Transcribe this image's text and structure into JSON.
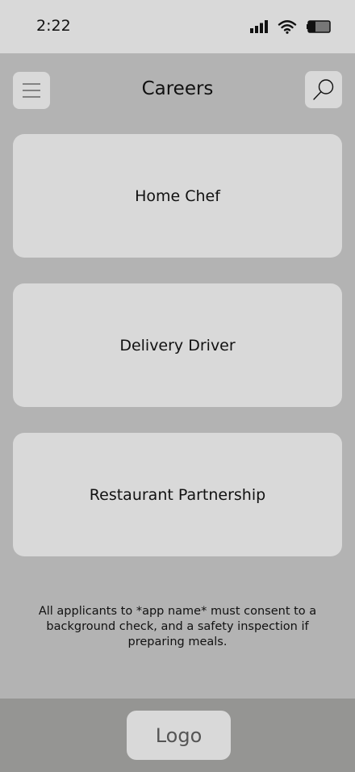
{
  "status_bar": {
    "time": "2:22",
    "icons": [
      "signal-icon",
      "wifi-icon",
      "battery-icon"
    ]
  },
  "header": {
    "title": "Careers",
    "menu_icon": "hamburger-menu-icon",
    "search_icon": "search-icon"
  },
  "careers": [
    {
      "label": "Home Chef"
    },
    {
      "label": "Delivery Driver"
    },
    {
      "label": "Restaurant Partnership"
    }
  ],
  "disclaimer": "All applicants to *app name* must consent to a background check, and a safety inspection if preparing meals.",
  "footer": {
    "logo_label": "Logo"
  },
  "colors": {
    "background": "#b3b3b3",
    "surface": "#d9d9d9",
    "footer": "#959593",
    "text": "#111111"
  }
}
